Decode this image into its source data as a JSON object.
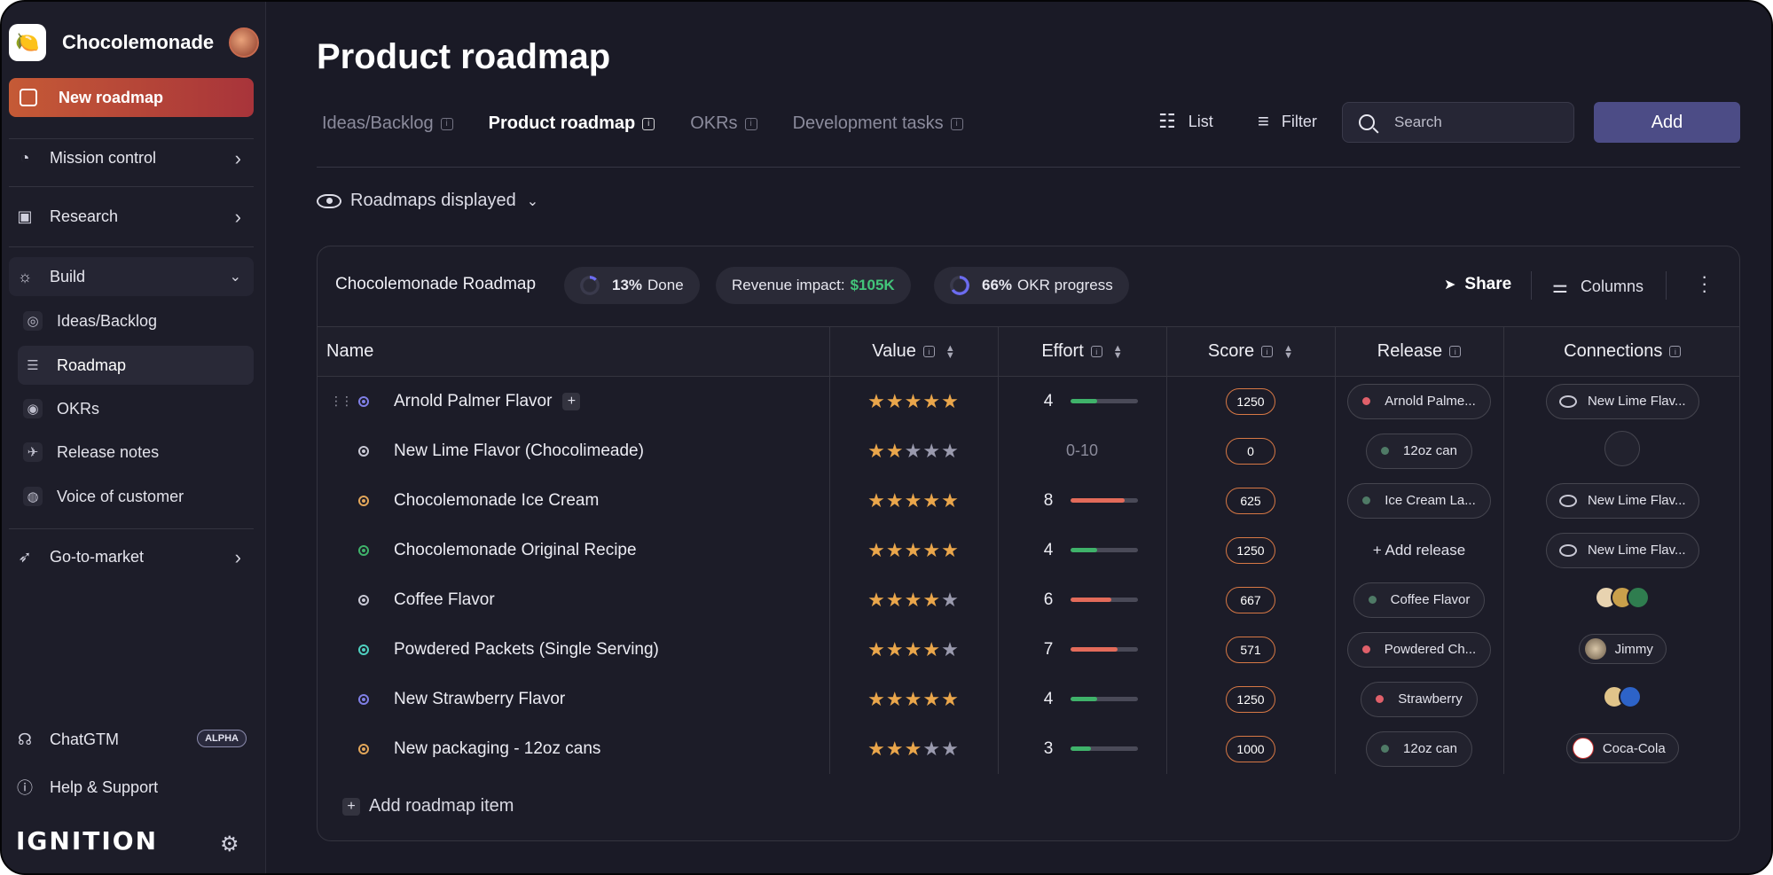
{
  "sidebar": {
    "brand_name": "Chocolemonade",
    "new_roadmap": "New roadmap",
    "nav": [
      {
        "label": "Mission control",
        "icon": "gauge-icon"
      },
      {
        "label": "Research",
        "icon": "book-icon"
      },
      {
        "label": "Build",
        "icon": "lightbulb-icon"
      }
    ],
    "build_items": [
      {
        "label": "Ideas/Backlog",
        "icon": "brain-icon"
      },
      {
        "label": "Roadmap",
        "icon": "roadmap-icon"
      },
      {
        "label": "OKRs",
        "icon": "target-icon"
      },
      {
        "label": "Release notes",
        "icon": "megaphone-icon"
      },
      {
        "label": "Voice of customer",
        "icon": "eye-icon"
      }
    ],
    "go_to_market": "Go-to-market",
    "chatgtm": "ChatGTM",
    "alpha_badge": "ALPHA",
    "help": "Help & Support",
    "logo_text": "IGNITION"
  },
  "header": {
    "title": "Product roadmap",
    "tabs": [
      "Ideas/Backlog",
      "Product roadmap",
      "OKRs",
      "Development tasks"
    ],
    "active_tab": "Product roadmap",
    "list_label": "List",
    "filter_label": "Filter",
    "search_placeholder": "Search",
    "add_label": "Add",
    "roadmaps_displayed": "Roadmaps displayed"
  },
  "card": {
    "title": "Chocolemonade Roadmap",
    "done_pct": "13%",
    "done_label": "Done",
    "revenue_label": "Revenue impact:",
    "revenue_value": "$105K",
    "okr_pct": "66%",
    "okr_label": "OKR progress",
    "share_label": "Share",
    "columns_label": "Columns",
    "add_item": "Add roadmap item"
  },
  "table": {
    "headers": [
      "Name",
      "Value",
      "Effort",
      "Score",
      "Release",
      "Connections"
    ],
    "rows": [
      {
        "name": "Arnold Palmer Flavor",
        "dot": "#7f7fe6",
        "stars": 5,
        "effort": "4",
        "effort_fill": 0.4,
        "effort_color": "#3fb26a",
        "score": "1250",
        "release": "Arnold Palme...",
        "release_dot": "#e0606a",
        "connection": "New Lime Flav..."
      },
      {
        "name": "New Lime Flavor (Chocolimeade)",
        "dot": "#c8c8d4",
        "stars": 2,
        "effort": "0-10",
        "effort_fill": null,
        "score": "0",
        "release": "12oz can",
        "release_dot": "#4f7a66",
        "connection": ""
      },
      {
        "name": "Chocolemonade Ice Cream",
        "dot": "#e2a65a",
        "stars": 5,
        "effort": "8",
        "effort_fill": 0.8,
        "effort_color": "#e36b5a",
        "score": "625",
        "release": "Ice Cream La...",
        "release_dot": "#4f7a66",
        "connection": "New Lime Flav..."
      },
      {
        "name": "Chocolemonade Original Recipe",
        "dot": "#3fb26a",
        "stars": 5,
        "effort": "4",
        "effort_fill": 0.4,
        "effort_color": "#3fb26a",
        "score": "1250",
        "release": "+ Add release",
        "release_dot": "",
        "connection": "New Lime Flav..."
      },
      {
        "name": "Coffee Flavor",
        "dot": "#c8c8d4",
        "stars": 4,
        "effort": "6",
        "effort_fill": 0.6,
        "effort_color": "#e36b5a",
        "score": "667",
        "release": "Coffee Flavor",
        "release_dot": "#4f7a66",
        "connection": ""
      },
      {
        "name": "Powdered Packets (Single Serving)",
        "dot": "#4fd0c0",
        "stars": 4,
        "effort": "7",
        "effort_fill": 0.7,
        "effort_color": "#e36b5a",
        "score": "571",
        "release": "Powdered Ch...",
        "release_dot": "#e0606a",
        "connection": "Jimmy"
      },
      {
        "name": "New Strawberry Flavor",
        "dot": "#7f7fe6",
        "stars": 5,
        "effort": "4",
        "effort_fill": 0.4,
        "effort_color": "#3fb26a",
        "score": "1250",
        "release": "Strawberry",
        "release_dot": "#e0606a",
        "connection": ""
      },
      {
        "name": "New packaging - 12oz cans",
        "dot": "#e2a65a",
        "stars": 3,
        "effort": "3",
        "effort_fill": 0.3,
        "effort_color": "#3fb26a",
        "score": "1000",
        "release": "12oz can",
        "release_dot": "#4f7a66",
        "connection": "Coca-Cola"
      }
    ]
  }
}
